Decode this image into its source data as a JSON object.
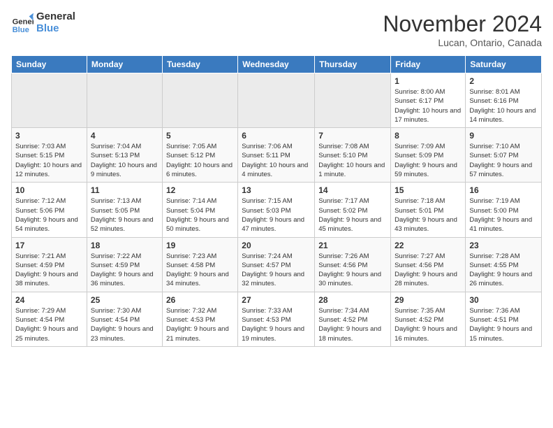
{
  "logo": {
    "line1": "General",
    "line2": "Blue"
  },
  "title": "November 2024",
  "location": "Lucan, Ontario, Canada",
  "weekdays": [
    "Sunday",
    "Monday",
    "Tuesday",
    "Wednesday",
    "Thursday",
    "Friday",
    "Saturday"
  ],
  "weeks": [
    [
      {
        "day": "",
        "info": ""
      },
      {
        "day": "",
        "info": ""
      },
      {
        "day": "",
        "info": ""
      },
      {
        "day": "",
        "info": ""
      },
      {
        "day": "",
        "info": ""
      },
      {
        "day": "1",
        "info": "Sunrise: 8:00 AM\nSunset: 6:17 PM\nDaylight: 10 hours and 17 minutes."
      },
      {
        "day": "2",
        "info": "Sunrise: 8:01 AM\nSunset: 6:16 PM\nDaylight: 10 hours and 14 minutes."
      }
    ],
    [
      {
        "day": "3",
        "info": "Sunrise: 7:03 AM\nSunset: 5:15 PM\nDaylight: 10 hours and 12 minutes."
      },
      {
        "day": "4",
        "info": "Sunrise: 7:04 AM\nSunset: 5:13 PM\nDaylight: 10 hours and 9 minutes."
      },
      {
        "day": "5",
        "info": "Sunrise: 7:05 AM\nSunset: 5:12 PM\nDaylight: 10 hours and 6 minutes."
      },
      {
        "day": "6",
        "info": "Sunrise: 7:06 AM\nSunset: 5:11 PM\nDaylight: 10 hours and 4 minutes."
      },
      {
        "day": "7",
        "info": "Sunrise: 7:08 AM\nSunset: 5:10 PM\nDaylight: 10 hours and 1 minute."
      },
      {
        "day": "8",
        "info": "Sunrise: 7:09 AM\nSunset: 5:09 PM\nDaylight: 9 hours and 59 minutes."
      },
      {
        "day": "9",
        "info": "Sunrise: 7:10 AM\nSunset: 5:07 PM\nDaylight: 9 hours and 57 minutes."
      }
    ],
    [
      {
        "day": "10",
        "info": "Sunrise: 7:12 AM\nSunset: 5:06 PM\nDaylight: 9 hours and 54 minutes."
      },
      {
        "day": "11",
        "info": "Sunrise: 7:13 AM\nSunset: 5:05 PM\nDaylight: 9 hours and 52 minutes."
      },
      {
        "day": "12",
        "info": "Sunrise: 7:14 AM\nSunset: 5:04 PM\nDaylight: 9 hours and 50 minutes."
      },
      {
        "day": "13",
        "info": "Sunrise: 7:15 AM\nSunset: 5:03 PM\nDaylight: 9 hours and 47 minutes."
      },
      {
        "day": "14",
        "info": "Sunrise: 7:17 AM\nSunset: 5:02 PM\nDaylight: 9 hours and 45 minutes."
      },
      {
        "day": "15",
        "info": "Sunrise: 7:18 AM\nSunset: 5:01 PM\nDaylight: 9 hours and 43 minutes."
      },
      {
        "day": "16",
        "info": "Sunrise: 7:19 AM\nSunset: 5:00 PM\nDaylight: 9 hours and 41 minutes."
      }
    ],
    [
      {
        "day": "17",
        "info": "Sunrise: 7:21 AM\nSunset: 4:59 PM\nDaylight: 9 hours and 38 minutes."
      },
      {
        "day": "18",
        "info": "Sunrise: 7:22 AM\nSunset: 4:59 PM\nDaylight: 9 hours and 36 minutes."
      },
      {
        "day": "19",
        "info": "Sunrise: 7:23 AM\nSunset: 4:58 PM\nDaylight: 9 hours and 34 minutes."
      },
      {
        "day": "20",
        "info": "Sunrise: 7:24 AM\nSunset: 4:57 PM\nDaylight: 9 hours and 32 minutes."
      },
      {
        "day": "21",
        "info": "Sunrise: 7:26 AM\nSunset: 4:56 PM\nDaylight: 9 hours and 30 minutes."
      },
      {
        "day": "22",
        "info": "Sunrise: 7:27 AM\nSunset: 4:56 PM\nDaylight: 9 hours and 28 minutes."
      },
      {
        "day": "23",
        "info": "Sunrise: 7:28 AM\nSunset: 4:55 PM\nDaylight: 9 hours and 26 minutes."
      }
    ],
    [
      {
        "day": "24",
        "info": "Sunrise: 7:29 AM\nSunset: 4:54 PM\nDaylight: 9 hours and 25 minutes."
      },
      {
        "day": "25",
        "info": "Sunrise: 7:30 AM\nSunset: 4:54 PM\nDaylight: 9 hours and 23 minutes."
      },
      {
        "day": "26",
        "info": "Sunrise: 7:32 AM\nSunset: 4:53 PM\nDaylight: 9 hours and 21 minutes."
      },
      {
        "day": "27",
        "info": "Sunrise: 7:33 AM\nSunset: 4:53 PM\nDaylight: 9 hours and 19 minutes."
      },
      {
        "day": "28",
        "info": "Sunrise: 7:34 AM\nSunset: 4:52 PM\nDaylight: 9 hours and 18 minutes."
      },
      {
        "day": "29",
        "info": "Sunrise: 7:35 AM\nSunset: 4:52 PM\nDaylight: 9 hours and 16 minutes."
      },
      {
        "day": "30",
        "info": "Sunrise: 7:36 AM\nSunset: 4:51 PM\nDaylight: 9 hours and 15 minutes."
      }
    ]
  ]
}
